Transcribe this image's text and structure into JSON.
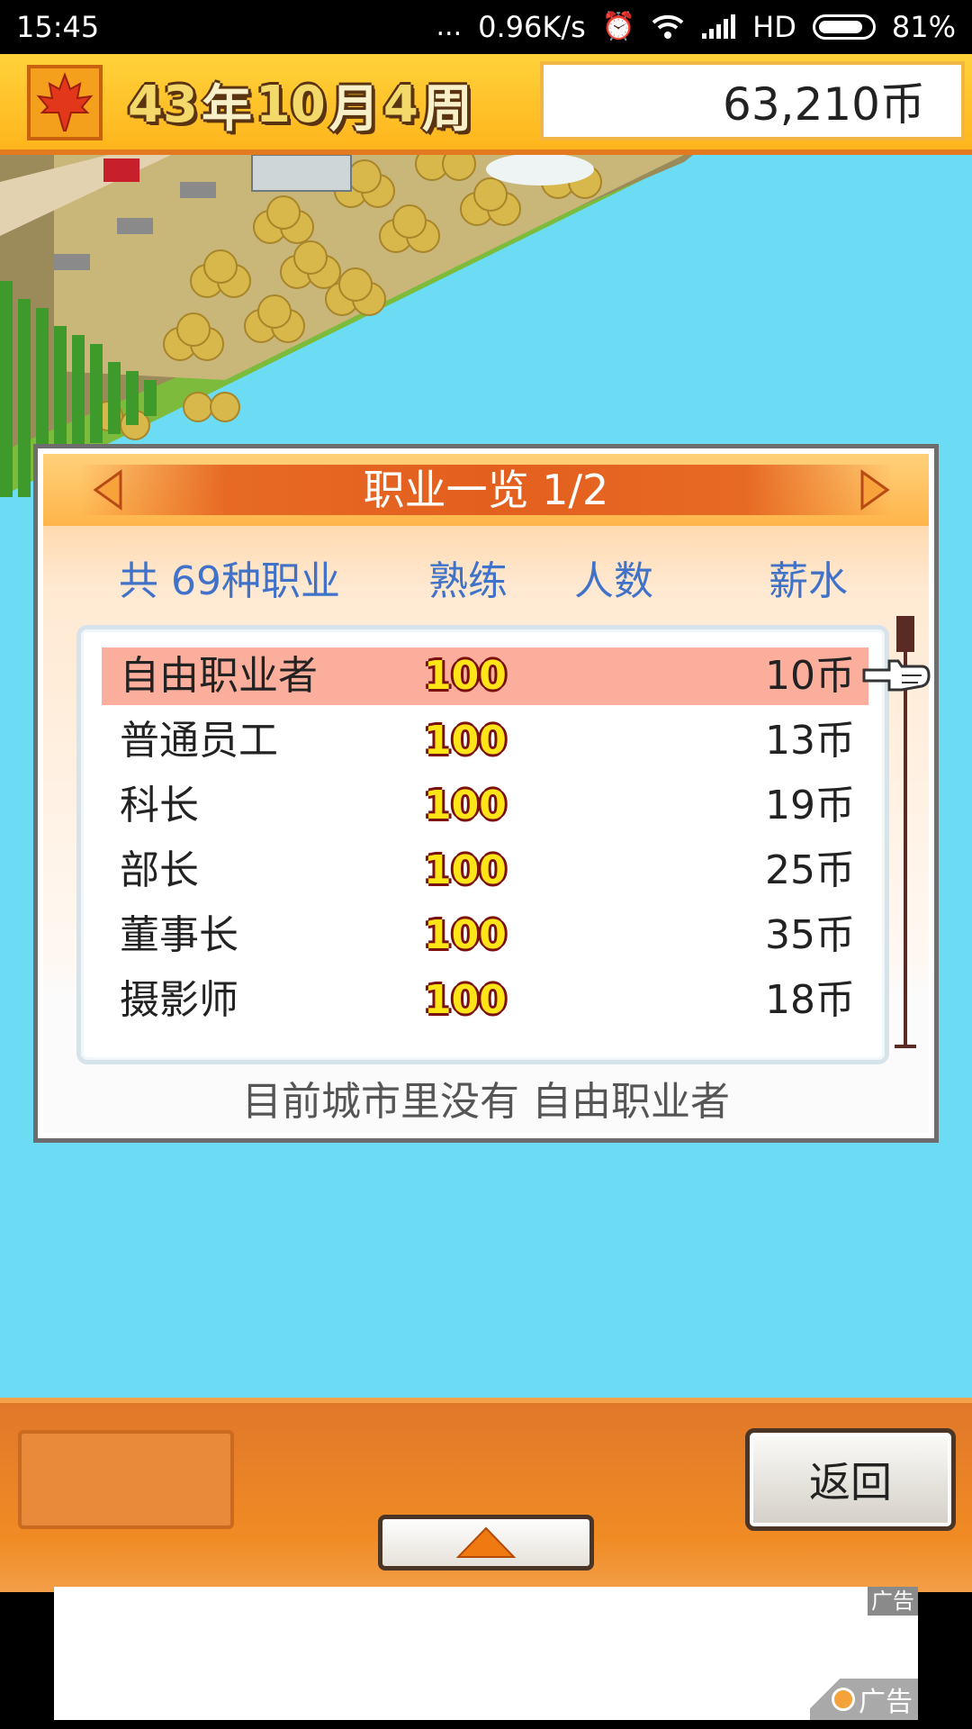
{
  "status_bar": {
    "time": "15:45",
    "dots": "...",
    "net_speed": "0.96K/s",
    "network": "HD",
    "battery": "81%",
    "battery_level": 0.81,
    "icons": [
      "alarm-icon",
      "wifi-icon",
      "signal-icon",
      "battery-icon"
    ]
  },
  "top_bar": {
    "logo_icon": "maple-leaf-icon",
    "date": {
      "year": "43",
      "year_unit": "年",
      "month": "10",
      "month_unit": "月",
      "week": "4",
      "week_unit": "周"
    },
    "money": "63,210币"
  },
  "panel": {
    "title": "职业一览 1/2",
    "prev_icon": "arrow-left-icon",
    "next_icon": "arrow-right-icon",
    "headers": {
      "total": "共 69种职业",
      "skill": "熟练",
      "count": "人数",
      "salary": "薪水"
    },
    "rows": [
      {
        "name": "自由职业者",
        "skill": "100",
        "count": "",
        "salary": "10币",
        "selected": true
      },
      {
        "name": "普通员工",
        "skill": "100",
        "count": "",
        "salary": "13币",
        "selected": false
      },
      {
        "name": "科长",
        "skill": "100",
        "count": "",
        "salary": "19币",
        "selected": false
      },
      {
        "name": "部长",
        "skill": "100",
        "count": "",
        "salary": "25币",
        "selected": false
      },
      {
        "name": "董事长",
        "skill": "100",
        "count": "",
        "salary": "35币",
        "selected": false
      },
      {
        "name": "摄影师",
        "skill": "100",
        "count": "",
        "salary": "18币",
        "selected": false
      }
    ],
    "scroll_position": 0,
    "note": "目前城市里没有 自由职业者"
  },
  "bottom_bar": {
    "up_icon": "triangle-up-icon",
    "back_label": "返回"
  },
  "ad": {
    "tag": "广告",
    "brand_label": "广告"
  },
  "colors": {
    "sky": "#6bdcf4",
    "accent_orange": "#e35f1e",
    "header_blue": "#3f72c8",
    "selected_row": "#fcae9c",
    "skill_yellow": "#ffe418"
  }
}
